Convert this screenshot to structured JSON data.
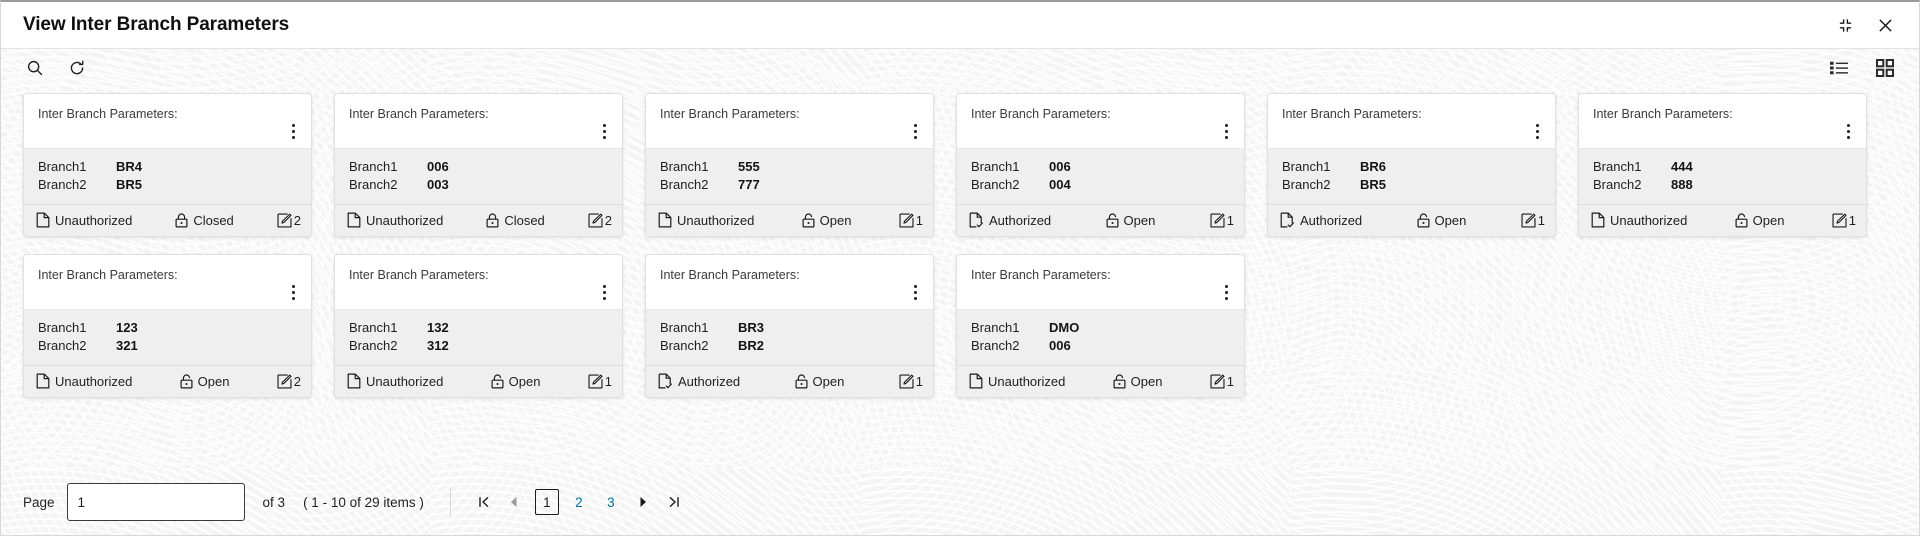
{
  "window": {
    "title": "View Inter Branch Parameters",
    "collapse_icon": "collapse-icon",
    "close_icon": "close-icon"
  },
  "toolbar": {
    "search_icon": "search-icon",
    "refresh_icon": "refresh-icon",
    "list_view_icon": "list-view-icon",
    "grid_view_icon": "grid-view-icon"
  },
  "card_labels": {
    "header": "Inter Branch Parameters:",
    "branch1": "Branch1",
    "branch2": "Branch2",
    "menu_icon": "kebab-menu-icon",
    "auth_icon": "document-icon",
    "lock_icon": "lock-icon",
    "edit_icon": "edit-icon"
  },
  "cards": [
    {
      "header": "Inter Branch Parameters:",
      "branch1_label": "Branch1",
      "branch1_value": "BR4",
      "branch2_label": "Branch2",
      "branch2_value": "BR5",
      "auth_status": "Unauthorized",
      "lock_status": "Closed",
      "count": "2"
    },
    {
      "header": "Inter Branch Parameters:",
      "branch1_label": "Branch1",
      "branch1_value": "006",
      "branch2_label": "Branch2",
      "branch2_value": "003",
      "auth_status": "Unauthorized",
      "lock_status": "Closed",
      "count": "2"
    },
    {
      "header": "Inter Branch Parameters:",
      "branch1_label": "Branch1",
      "branch1_value": "555",
      "branch2_label": "Branch2",
      "branch2_value": "777",
      "auth_status": "Unauthorized",
      "lock_status": "Open",
      "count": "1"
    },
    {
      "header": "Inter Branch Parameters:",
      "branch1_label": "Branch1",
      "branch1_value": "006",
      "branch2_label": "Branch2",
      "branch2_value": "004",
      "auth_status": "Authorized",
      "lock_status": "Open",
      "count": "1"
    },
    {
      "header": "Inter Branch Parameters:",
      "branch1_label": "Branch1",
      "branch1_value": "BR6",
      "branch2_label": "Branch2",
      "branch2_value": "BR5",
      "auth_status": "Authorized",
      "lock_status": "Open",
      "count": "1"
    },
    {
      "header": "Inter Branch Parameters:",
      "branch1_label": "Branch1",
      "branch1_value": "444",
      "branch2_label": "Branch2",
      "branch2_value": "888",
      "auth_status": "Unauthorized",
      "lock_status": "Open",
      "count": "1"
    },
    {
      "header": "Inter Branch Parameters:",
      "branch1_label": "Branch1",
      "branch1_value": "123",
      "branch2_label": "Branch2",
      "branch2_value": "321",
      "auth_status": "Unauthorized",
      "lock_status": "Open",
      "count": "2"
    },
    {
      "header": "Inter Branch Parameters:",
      "branch1_label": "Branch1",
      "branch1_value": "132",
      "branch2_label": "Branch2",
      "branch2_value": "312",
      "auth_status": "Unauthorized",
      "lock_status": "Open",
      "count": "1"
    },
    {
      "header": "Inter Branch Parameters:",
      "branch1_label": "Branch1",
      "branch1_value": "BR3",
      "branch2_label": "Branch2",
      "branch2_value": "BR2",
      "auth_status": "Authorized",
      "lock_status": "Open",
      "count": "1"
    },
    {
      "header": "Inter Branch Parameters:",
      "branch1_label": "Branch1",
      "branch1_value": "DMO",
      "branch2_label": "Branch2",
      "branch2_value": "006",
      "auth_status": "Unauthorized",
      "lock_status": "Open",
      "count": "1"
    }
  ],
  "pagination": {
    "page_label": "Page",
    "page_value": "1",
    "of_label": "of 3",
    "range_label": "( 1 - 10 of 29 items )",
    "pages": [
      {
        "label": "1",
        "active": true
      },
      {
        "label": "2",
        "active": false
      },
      {
        "label": "3",
        "active": false
      }
    ],
    "first_icon": "first-page-icon",
    "prev_icon": "prev-page-icon",
    "next_icon": "next-page-icon",
    "last_icon": "last-page-icon"
  },
  "colors": {
    "link": "#0073a8",
    "card_body_bg": "#efefef",
    "canvas_bg": "#f4f4f4",
    "text": "#1f1f1f"
  }
}
